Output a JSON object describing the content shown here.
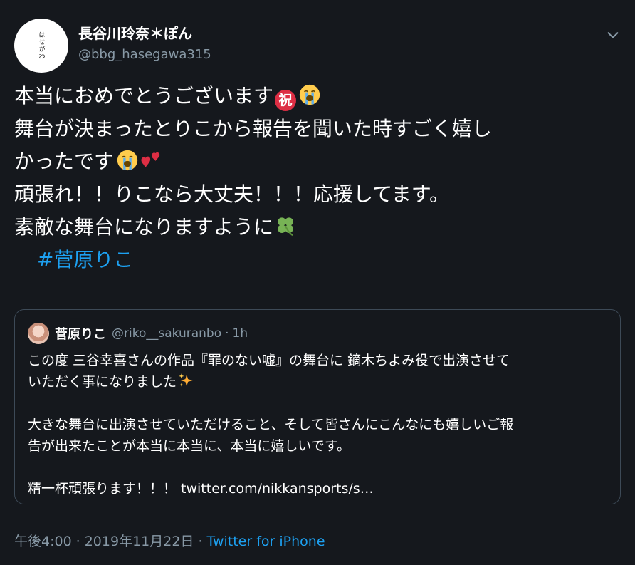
{
  "author": {
    "avatar_text": "はせがわ",
    "display_name": "長谷川玲奈＊ぽん",
    "handle": "@bbg_hasegawa315"
  },
  "tweet": {
    "line1": "本当におめでとうございます",
    "line2": "舞台が決まったとりこから報告を聞いた時すごく嬉し",
    "line3": "かったです",
    "line4": "頑張れ！！りこなら大丈夫！！！応援してます。",
    "line5": "素敵な舞台になりますように",
    "hashtag": "#菅原りこ",
    "iwai_emoji_char": "祝",
    "icons": [
      "chevron-down-icon",
      "congratulation-emoji",
      "crying-face-emoji",
      "two-hearts-emoji",
      "four-leaf-clover-emoji",
      "sparkles-emoji"
    ]
  },
  "quote": {
    "name": "菅原りこ",
    "handle": "@riko__sakuranbo",
    "dot": "·",
    "time": "1h",
    "line1": "この度 三谷幸喜さんの作品『罪のない嘘』の舞台に 鏑木ちよみ役で出演させて",
    "line2": "いただく事になりました",
    "line3": "大きな舞台に出演させていただけること、そして皆さんにこんなにも嬉しいご報",
    "line4": "告が出来たことが本当に本当に、本当に嬉しいです。",
    "line5": "精一杯頑張ります！！！ twitter.com/nikkansports/s…"
  },
  "footer": {
    "time": "午後4:00",
    "sep1": "·",
    "date": "2019年11月22日",
    "sep2": "·",
    "source": "Twitter for iPhone"
  },
  "colors": {
    "background": "#15181d",
    "link": "#1da1f2",
    "muted": "#8899a6",
    "border": "#3d4a57"
  }
}
